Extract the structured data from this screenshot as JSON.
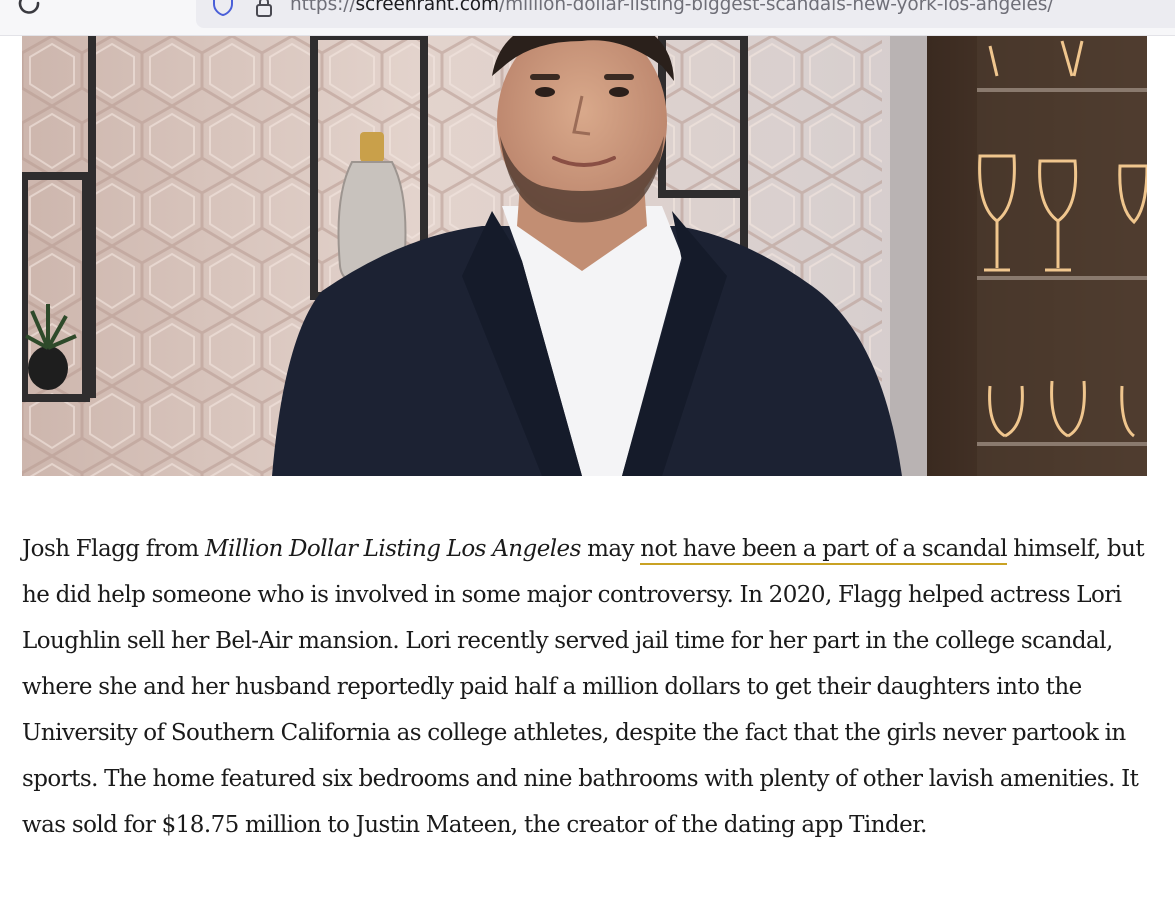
{
  "browser": {
    "url_host": "screenrant.com",
    "url_scheme": "https://",
    "url_path": "/million-dollar-listing-biggest-scandals-new-york-los-angeles/",
    "icons": [
      "reload-icon",
      "shield-icon",
      "lock-icon"
    ]
  },
  "hero_image": {
    "description_icon": "photo-josh-flagg"
  },
  "article": {
    "p1_before_title": "Josh Flagg from ",
    "p1_title": "Million Dollar Listing Los Angeles",
    "p1_after_title": " may ",
    "p1_link": "not have been a part of a scandal",
    "p1_rest": " himself, but he did help someone who is involved in some major controversy. In 2020, Flagg helped actress Lori Loughlin sell her Bel-Air mansion. Lori recently served jail time for her part in the college scandal, where she and her husband reportedly paid half a million dollars to get their daughters into the University of Southern California as college athletes, despite the fact that the girls never partook in sports. The home featured six bedrooms and nine bathrooms with plenty of other lavish amenities. It was sold for $18.75 million to Justin Mateen, the creator of the dating app Tinder."
  },
  "colors": {
    "link_underline": "#c9a224",
    "text": "#1a1a1a"
  }
}
